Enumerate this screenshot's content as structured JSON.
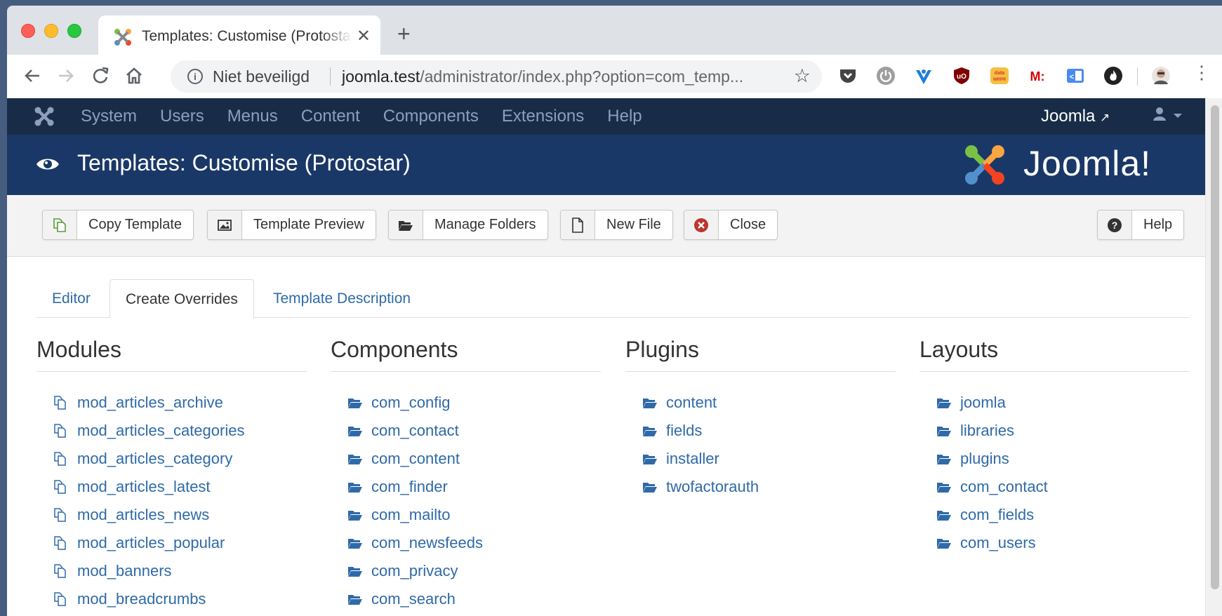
{
  "browser": {
    "tab_title": "Templates: Customise (Protostar)",
    "tab_close": "✕",
    "new_tab": "+",
    "security_label": "Niet beveiligd",
    "url_host": "joomla.test",
    "url_path": "/administrator/index.php?option=com_temp...",
    "extensions": [
      "pocket-icon",
      "power-icon",
      "vivaldi-icon",
      "ublock-icon",
      "datawrapper-icon",
      "mega-icon",
      "translate-icon",
      "fire-icon",
      "profile-avatar"
    ]
  },
  "admin_nav": {
    "menu": [
      "System",
      "Users",
      "Menus",
      "Content",
      "Components",
      "Extensions",
      "Help"
    ],
    "site_link": "Joomla"
  },
  "header": {
    "title": "Templates: Customise (Protostar)",
    "brand": "Joomla!"
  },
  "toolbar": {
    "copy_template": "Copy Template",
    "template_preview": "Template Preview",
    "manage_folders": "Manage Folders",
    "new_file": "New File",
    "close": "Close",
    "help": "Help"
  },
  "tabs": {
    "editor": "Editor",
    "create_overrides": "Create Overrides",
    "template_description": "Template Description"
  },
  "modules": {
    "heading": "Modules",
    "items": [
      "mod_articles_archive",
      "mod_articles_categories",
      "mod_articles_category",
      "mod_articles_latest",
      "mod_articles_news",
      "mod_articles_popular",
      "mod_banners",
      "mod_breadcrumbs"
    ]
  },
  "components": {
    "heading": "Components",
    "items": [
      "com_config",
      "com_contact",
      "com_content",
      "com_finder",
      "com_mailto",
      "com_newsfeeds",
      "com_privacy",
      "com_search"
    ]
  },
  "plugins": {
    "heading": "Plugins",
    "items": [
      "content",
      "fields",
      "installer",
      "twofactorauth"
    ]
  },
  "layouts": {
    "heading": "Layouts",
    "items": [
      "joomla",
      "libraries",
      "plugins",
      "com_contact",
      "com_fields",
      "com_users"
    ]
  }
}
